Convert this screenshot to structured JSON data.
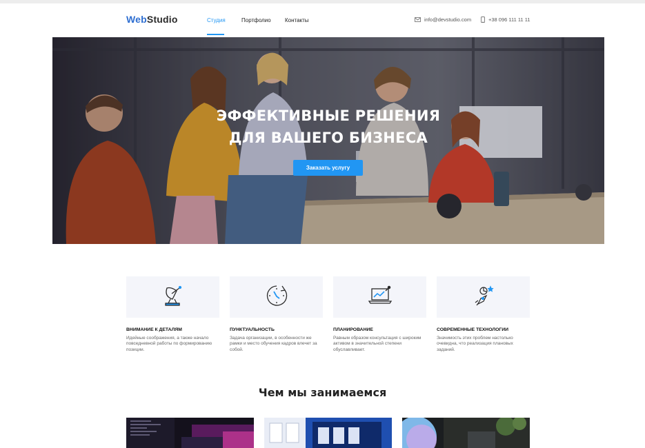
{
  "header": {
    "logo": {
      "accent": "Web",
      "rest": "Studio"
    },
    "nav": [
      {
        "label": "Студия",
        "active": true
      },
      {
        "label": "Портфолио",
        "active": false
      },
      {
        "label": "Контакты",
        "active": false
      }
    ],
    "email": "info@devstudio.com",
    "phone": "+38 096 111 11 11",
    "email_icon": "mail-icon",
    "phone_icon": "phone-icon"
  },
  "hero": {
    "title_line1": "ЭФФЕКТИВНЫЕ РЕШЕНИЯ",
    "title_line2": "ДЛЯ ВАШЕГО БИЗНЕСА",
    "button": "Заказать услугу"
  },
  "features": [
    {
      "icon": "satellite-dish-icon",
      "title": "ВНИМАНИЕ К ДЕТАЛЯМ",
      "text": "Идейные соображения, а также начало повседневной работы по формированию позиции."
    },
    {
      "icon": "clock-icon",
      "title": "ПУНКТУАЛЬНОСТЬ",
      "text": "Задача организации, в особенности же рамки и место обучения кадров влечет за собой."
    },
    {
      "icon": "laptop-chart-icon",
      "title": "ПЛАНИРОВАНИЕ",
      "text": "Равным образом консультация с широким активом в значительной степени обуславливает."
    },
    {
      "icon": "rocket-icon",
      "title": "СОВРЕМЕННЫЕ ТЕХНОЛОГИИ",
      "text": "Значимость этих проблем настолько очевидна, что реализация плановых заданий."
    }
  ],
  "section": {
    "title": "Чем мы занимаемся"
  },
  "colors": {
    "accent": "#2196f3",
    "logo_accent": "#2f6fd1",
    "feature_bg": "#f4f5fa"
  }
}
